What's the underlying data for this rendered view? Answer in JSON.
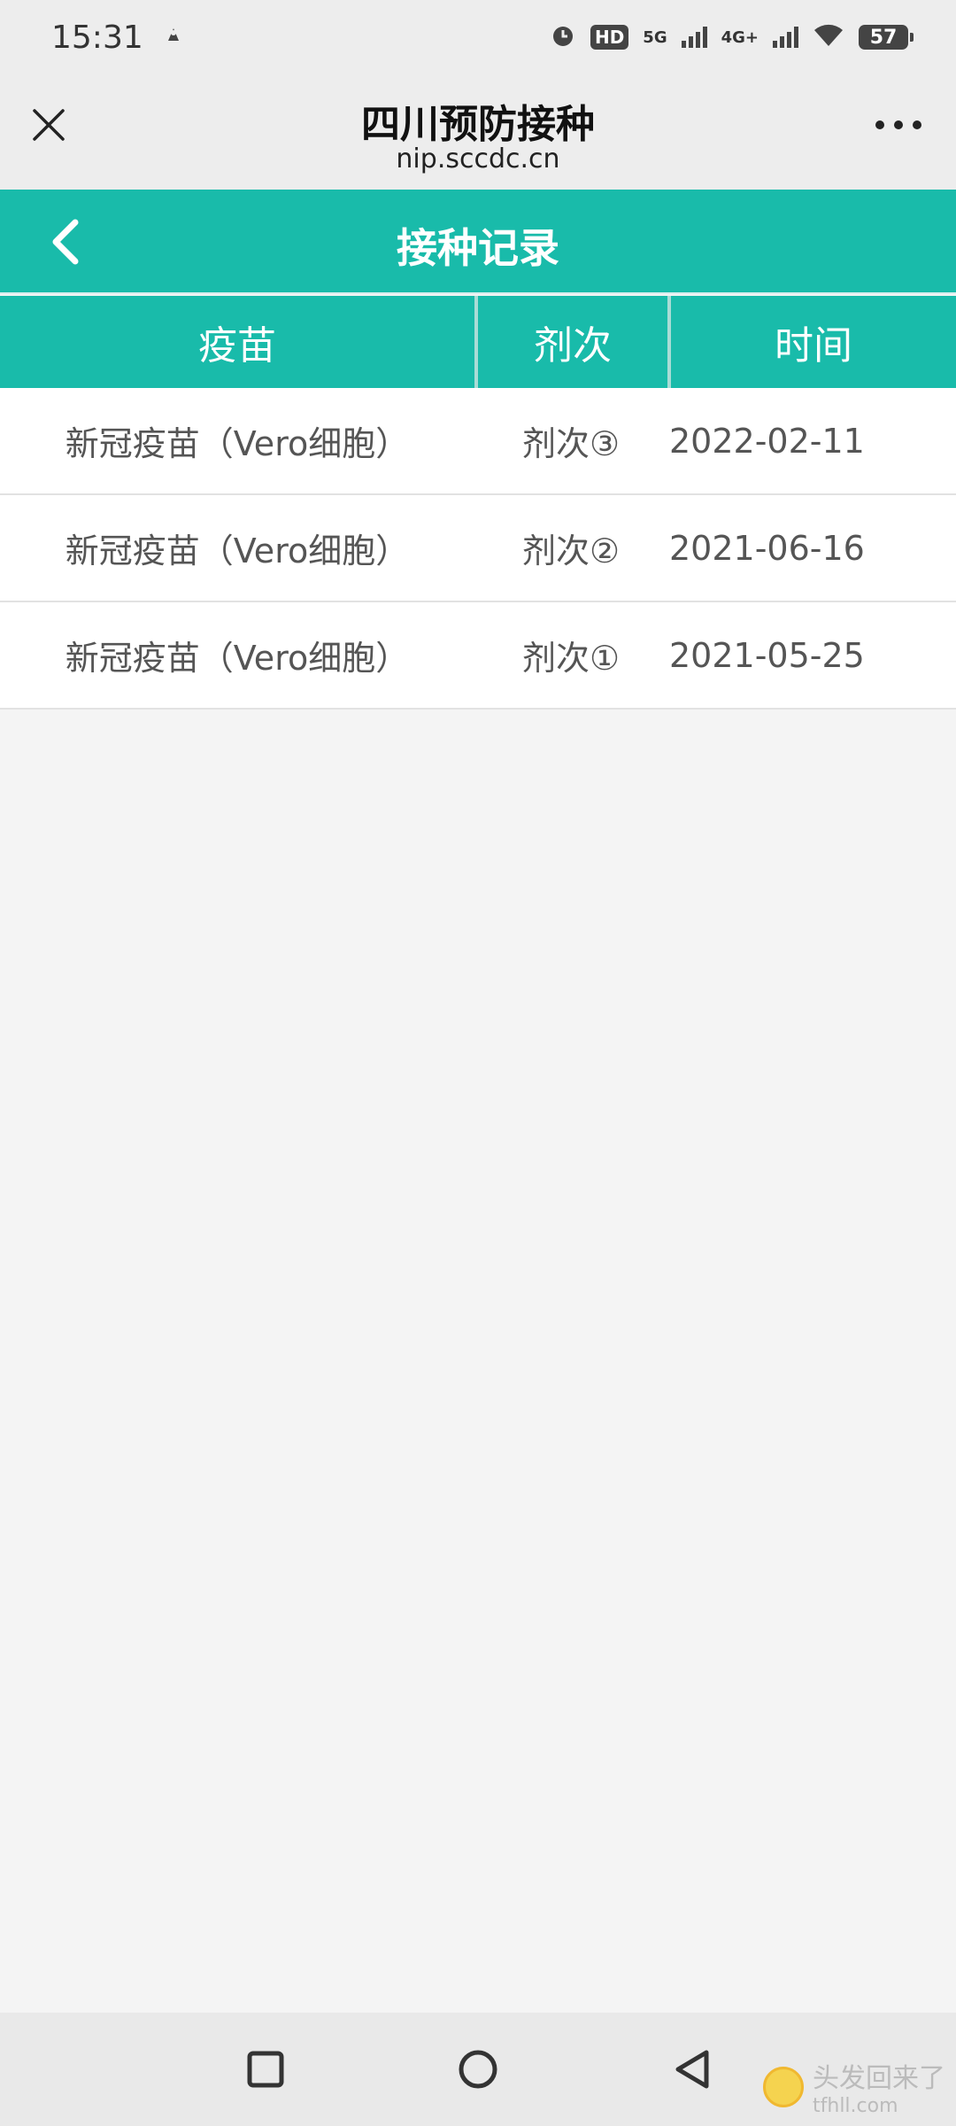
{
  "status_bar": {
    "time": "15:31",
    "hd_label": "HD",
    "net_5g": "5G",
    "net_4g": "4G+",
    "battery": "57"
  },
  "browser": {
    "title": "四川预防接种",
    "url": "nip.sccdc.cn"
  },
  "page": {
    "title": "接种记录"
  },
  "table": {
    "headers": [
      "疫苗",
      "剂次",
      "时间"
    ],
    "rows": [
      {
        "vaccine": "新冠疫苗（Vero细胞）",
        "dose": "剂次③",
        "date": "2022-02-11"
      },
      {
        "vaccine": "新冠疫苗（Vero细胞）",
        "dose": "剂次②",
        "date": "2021-06-16"
      },
      {
        "vaccine": "新冠疫苗（Vero细胞）",
        "dose": "剂次①",
        "date": "2021-05-25"
      }
    ]
  },
  "watermark": {
    "text": "头发回来了",
    "url": "tfhll.com"
  },
  "colors": {
    "accent": "#19bbaa",
    "background": "#f4f4f4"
  }
}
